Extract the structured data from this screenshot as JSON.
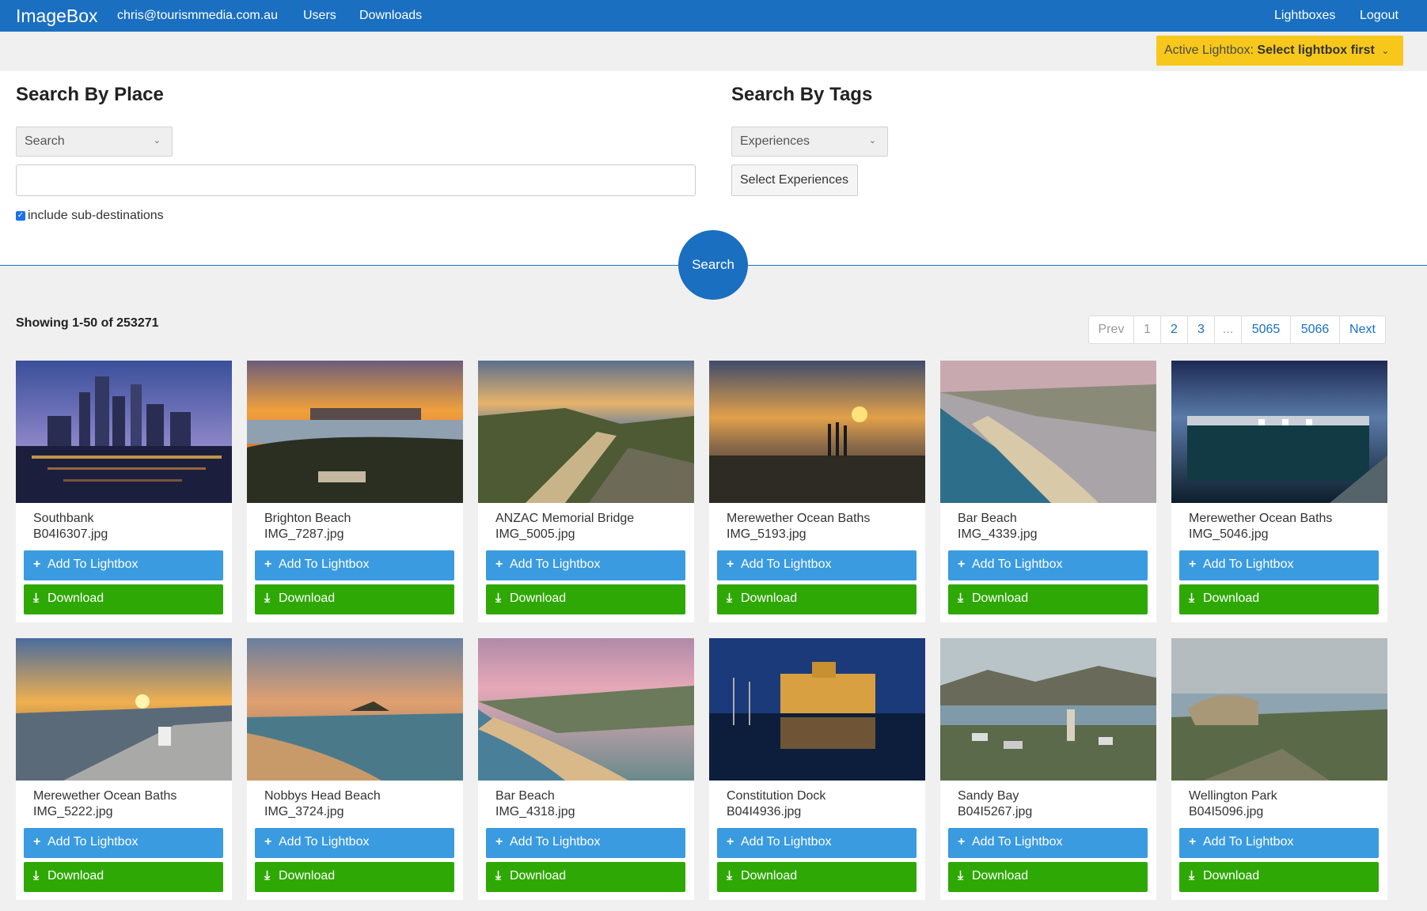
{
  "nav": {
    "brand": "ImageBox",
    "email": "chris@tourismmedia.com.au",
    "users": "Users",
    "downloads": "Downloads",
    "lightboxes": "Lightboxes",
    "logout": "Logout"
  },
  "lightbox": {
    "label": "Active Lightbox:",
    "value": "Select lightbox first",
    "chevron": "⌄"
  },
  "place": {
    "heading": "Search By Place",
    "select_value": "Search",
    "input_value": "",
    "checkbox_label": "include sub-destinations",
    "checkbox_checked": true
  },
  "tags": {
    "heading": "Search By Tags",
    "select_value": "Experiences",
    "button_label": "Select Experiences"
  },
  "search_button": "Search",
  "results": {
    "summary": "Showing 1-50 of 253271",
    "pagination": [
      "Prev",
      "1",
      "2",
      "3",
      "...",
      "5065",
      "5066",
      "Next"
    ]
  },
  "card_buttons": {
    "add": "Add To Lightbox",
    "download": "Download"
  },
  "cards": [
    {
      "title": "Southbank",
      "file": "B04I6307.jpg"
    },
    {
      "title": "Brighton Beach",
      "file": "IMG_7287.jpg"
    },
    {
      "title": "ANZAC Memorial Bridge",
      "file": "IMG_5005.jpg"
    },
    {
      "title": "Merewether Ocean Baths",
      "file": "IMG_5193.jpg"
    },
    {
      "title": "Bar Beach",
      "file": "IMG_4339.jpg"
    },
    {
      "title": "Merewether Ocean Baths",
      "file": "IMG_5046.jpg"
    },
    {
      "title": "Merewether Ocean Baths",
      "file": "IMG_5222.jpg"
    },
    {
      "title": "Nobbys Head Beach",
      "file": "IMG_3724.jpg"
    },
    {
      "title": "Bar Beach",
      "file": "IMG_4318.jpg"
    },
    {
      "title": "Constitution Dock",
      "file": "B04I4936.jpg"
    },
    {
      "title": "Sandy Bay",
      "file": "B04I5267.jpg"
    },
    {
      "title": "Wellington Park",
      "file": "B04I5096.jpg"
    }
  ]
}
